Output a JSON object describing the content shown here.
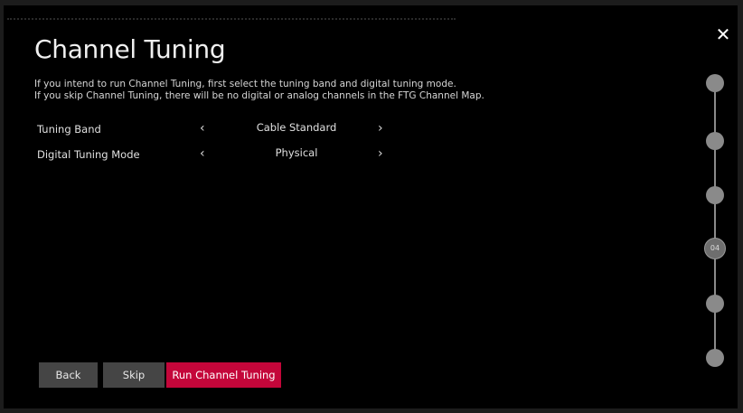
{
  "dialog": {
    "title": "Channel Tuning",
    "close_icon": "close-icon",
    "description": [
      "If you intend to run Channel Tuning, first select the tuning band and digital tuning mode.",
      "If you skip Channel Tuning, there will be no digital or analog channels in the FTG Channel Map."
    ]
  },
  "settings": [
    {
      "label": "Tuning Band",
      "value": "Cable Standard"
    },
    {
      "label": "Digital Tuning Mode",
      "value": "Physical"
    }
  ],
  "buttons": {
    "back": "Back",
    "skip": "Skip",
    "run": "Run Channel Tuning"
  },
  "stepper": {
    "active_label": "04",
    "steps_total": 6,
    "active_index": 4
  },
  "colors": {
    "accent": "#c4063a",
    "button_gray": "#454545",
    "background": "#000000"
  }
}
